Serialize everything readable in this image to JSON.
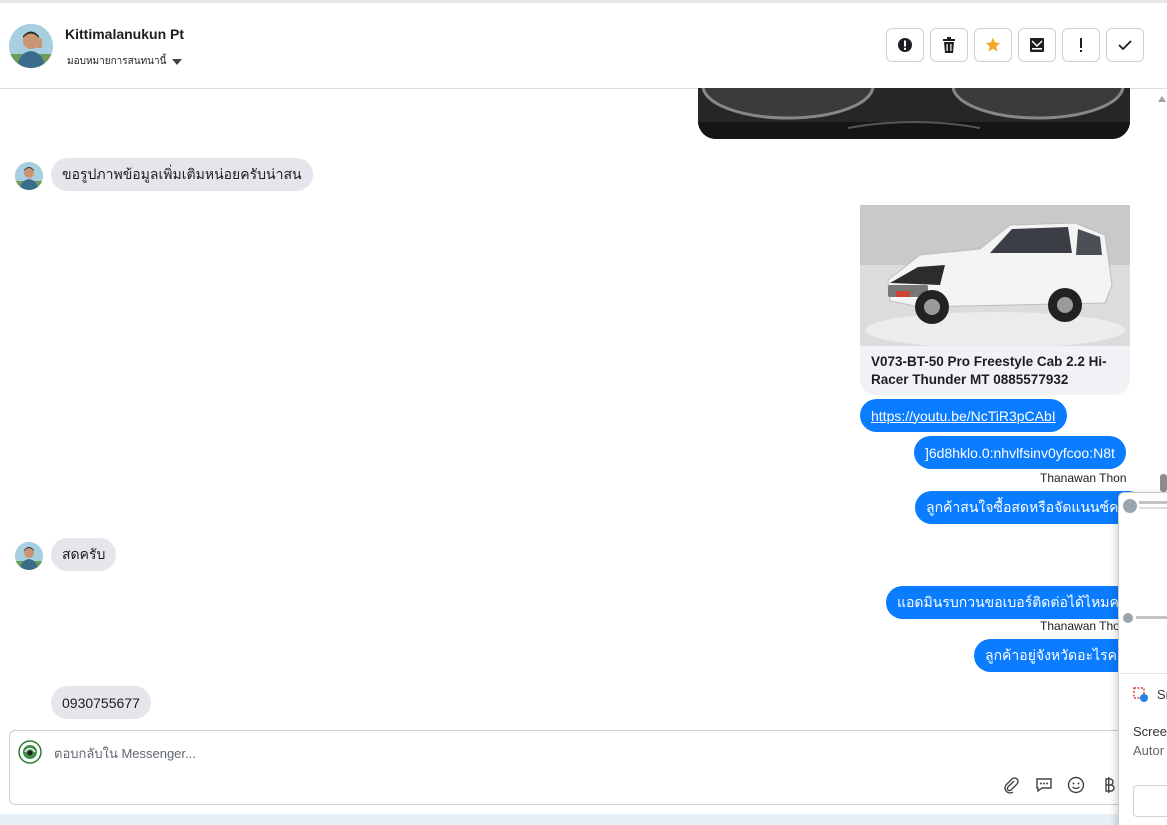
{
  "header": {
    "contact_name": "Kittimalanukun Pt",
    "assign_label": "มอบหมายการสนทนานี้",
    "actions": [
      {
        "name": "report-icon"
      },
      {
        "name": "trash-icon"
      },
      {
        "name": "star-icon"
      },
      {
        "name": "mark-unread-icon"
      },
      {
        "name": "important-icon"
      },
      {
        "name": "done-icon"
      }
    ],
    "star_color": "#f5a623"
  },
  "thread": {
    "msg_request_photos": "ขอรูปภาพข้อมูลเพิ่มเติมหน่อยครับน่าสน",
    "card_title": "V073-BT-50 Pro Freestyle Cab 2.2 Hi-Racer Thunder MT 0885577932",
    "msg_link": "https://youtu.be/NcTiR3pCAbI",
    "msg_code": "]6d8hklo.0:nhvlfsinv0yfcoo:N8t",
    "sender_1": "Thanawan Thon",
    "msg_cash_or_finance": "ลูกค้าสนใจซื้อสดหรือจัดแนนซ์คะ",
    "msg_cash": "สดครับ",
    "msg_ask_phone": "แอดมินรบกวนขอเบอร์ติดต่อได้ไหมคะ",
    "sender_2": "Thanawan Thon",
    "msg_ask_province": "ลูกค้าอยู่จังหวัดอะไรคะ",
    "msg_phone": "0930755677"
  },
  "composer": {
    "placeholder": "ตอบกลับใน Messenger..."
  },
  "popup": {
    "row1": "Sn",
    "row2": "Scree",
    "row3": "Autor"
  },
  "colors": {
    "outgoing": "#0a7cff",
    "incoming": "#e4e6eb"
  }
}
